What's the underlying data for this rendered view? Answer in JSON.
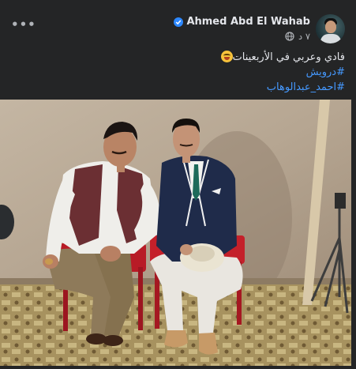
{
  "post": {
    "author_name": "Ahmed Abd El Wahab",
    "timestamp": "٧ د",
    "caption_line": "فادي وعربي في الأربعينات",
    "hashtags": [
      "#درويش",
      "#احمد_عبدالوهاب"
    ],
    "more_icon": "more-options-icon",
    "privacy_icon": "globe-icon",
    "verified_icon": "verified-badge-icon",
    "emoji": "grinning-face-tongue-emoji"
  },
  "colors": {
    "card_background": "#242526",
    "primary_text": "#e4e6eb",
    "secondary_text": "#b0b3b8",
    "hashtag_link": "#4599ff",
    "verified_badge": "#2d88ff"
  }
}
